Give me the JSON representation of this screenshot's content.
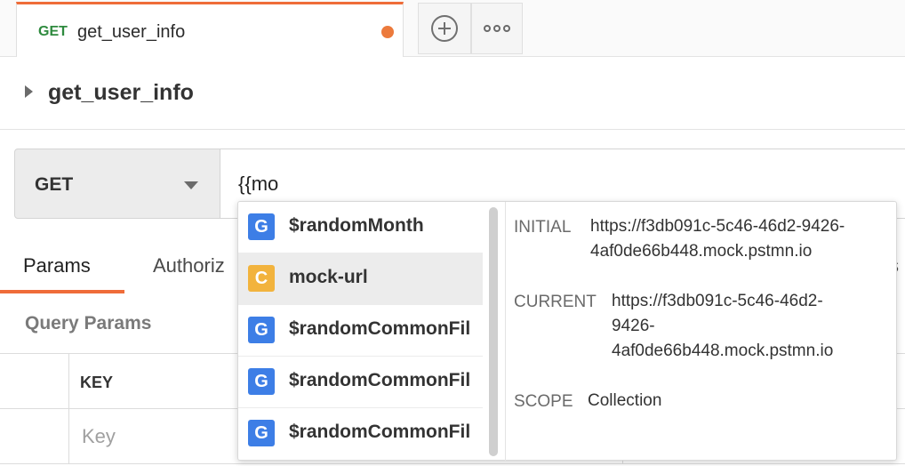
{
  "tab": {
    "method": "GET",
    "title": "get_user_info",
    "unsaved_color": "#ec7a3c"
  },
  "tabbar": {
    "add_icon": "plus-circle-icon",
    "more_icon": "ellipsis-icon"
  },
  "request": {
    "title": "get_user_info"
  },
  "urlbar": {
    "method": "GET",
    "url_value": "{{mo"
  },
  "request_tabs": {
    "params": "Params",
    "authorization": "Authoriz",
    "cut_off": "s"
  },
  "query_params": {
    "label": "Query Params",
    "key_header": "KEY",
    "key_placeholder": "Key"
  },
  "autocomplete": {
    "suggestions": [
      {
        "badge": "G",
        "label": "$randomMonth"
      },
      {
        "badge": "C",
        "label": "mock-url"
      },
      {
        "badge": "G",
        "label": "$randomCommonFil"
      },
      {
        "badge": "G",
        "label": "$randomCommonFil"
      },
      {
        "badge": "G",
        "label": "$randomCommonFil"
      }
    ],
    "detail": {
      "initial_label": "INITIAL",
      "initial_line1": "https://f3db091c-5c46-46d2-9426-",
      "initial_line2": "4af0de66b448.mock.pstmn.io",
      "current_label": "CURRENT",
      "current_line1": "https://f3db091c-5c46-46d2-",
      "current_line2": "9426-",
      "current_line3": "4af0de66b448.mock.pstmn.io",
      "scope_label": "SCOPE",
      "scope_value": "Collection"
    }
  },
  "colors": {
    "accent": "#ef6c39",
    "get_method": "#2e8a3e",
    "global_badge": "#3d7ee6",
    "collection_badge": "#f2b33d"
  }
}
